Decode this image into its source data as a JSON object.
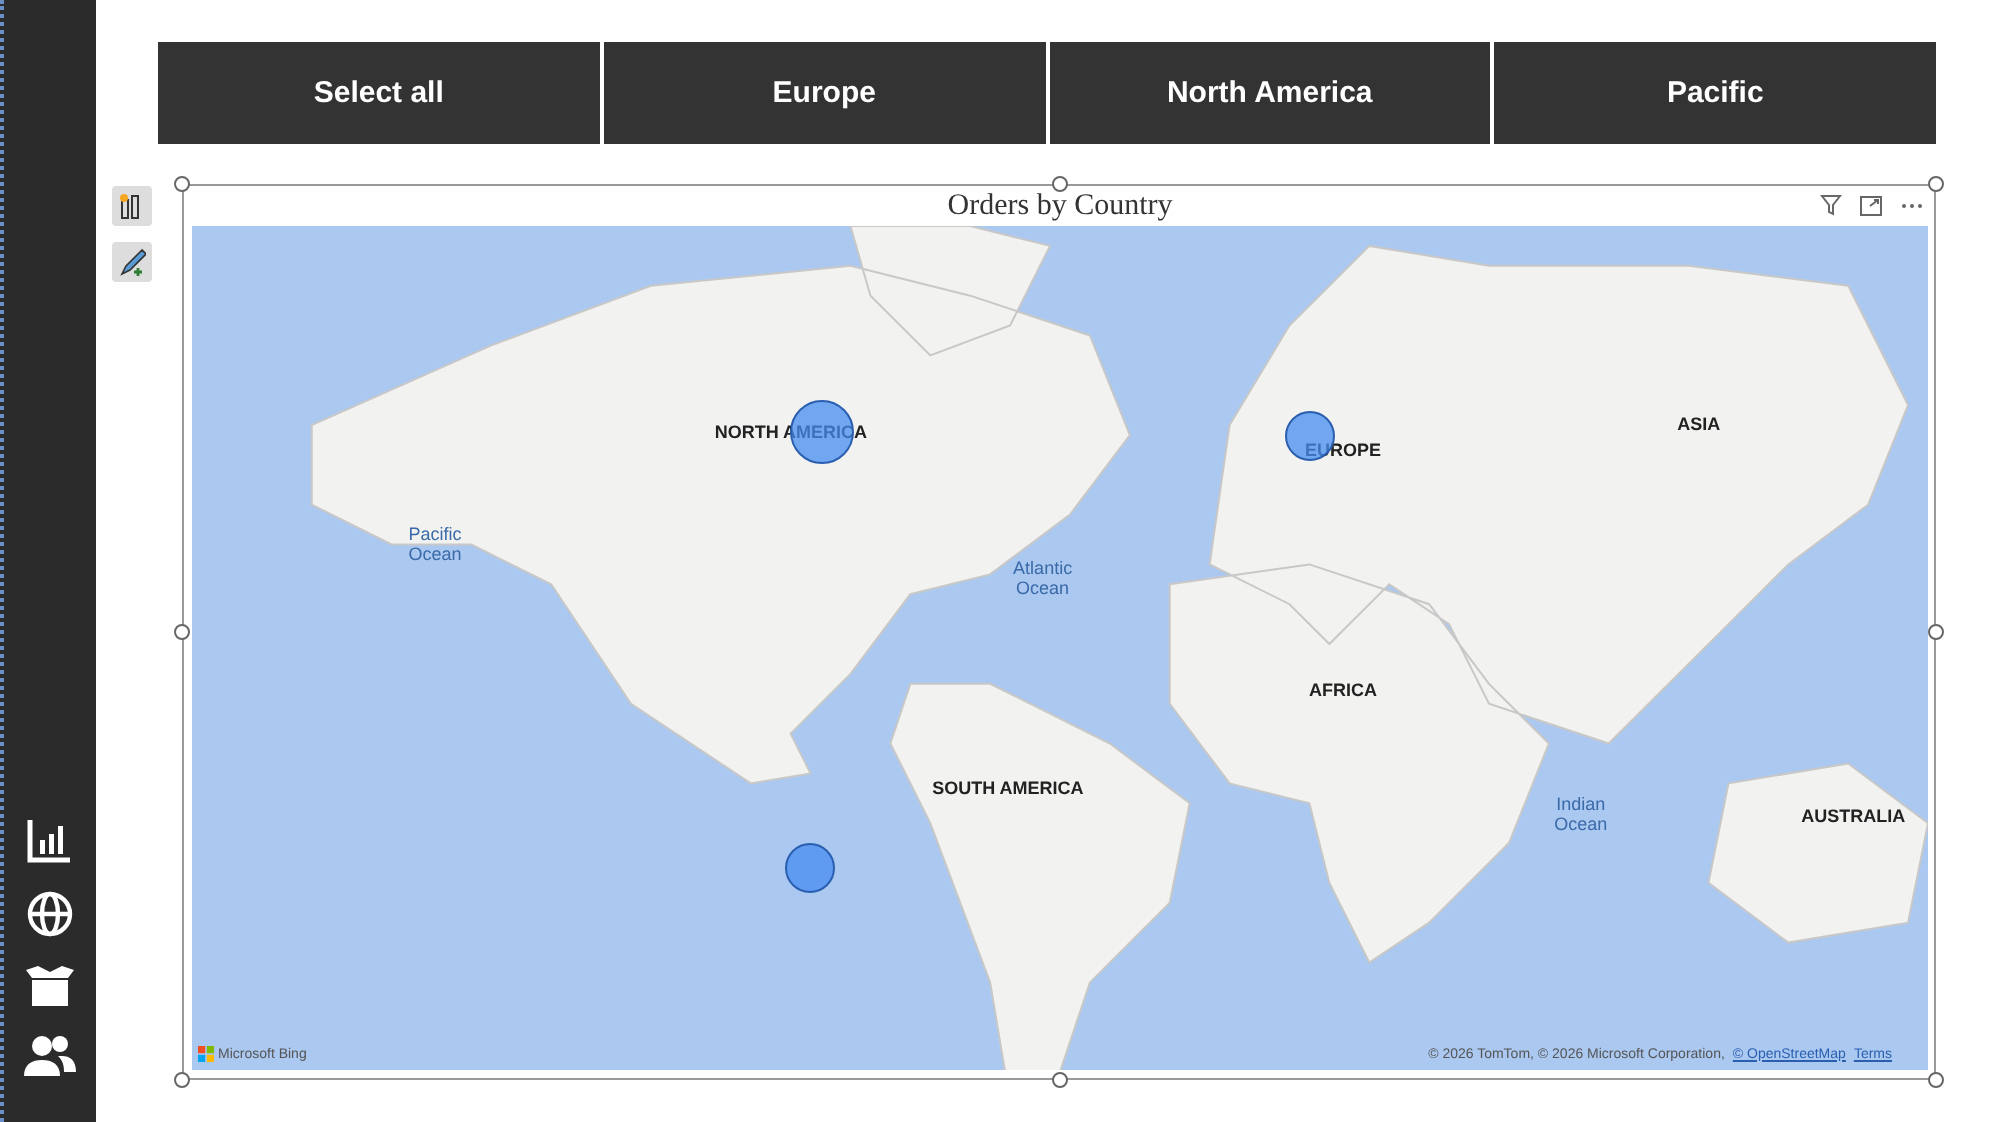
{
  "slicer": {
    "buttons": [
      {
        "label": "Select all",
        "selected": false
      },
      {
        "label": "Europe",
        "selected": false
      },
      {
        "label": "North America",
        "selected": false
      },
      {
        "label": "Pacific",
        "selected": false
      }
    ]
  },
  "visual": {
    "title": "Orders by Country",
    "map": {
      "labels": [
        {
          "text": "NORTH AMERICA",
          "kind": "continent"
        },
        {
          "text": "EUROPE",
          "kind": "continent"
        },
        {
          "text": "ASIA",
          "kind": "continent"
        },
        {
          "text": "AFRICA",
          "kind": "continent"
        },
        {
          "text": "SOUTH AMERICA",
          "kind": "continent"
        },
        {
          "text": "AUSTRALIA",
          "kind": "continent"
        },
        {
          "text": "Pacific\nOcean",
          "kind": "ocean"
        },
        {
          "text": "Atlantic\nOcean",
          "kind": "ocean"
        },
        {
          "text": "Indian\nOcean",
          "kind": "ocean"
        }
      ],
      "bubbles": [
        {
          "kind": "large"
        },
        {
          "kind": "small"
        },
        {
          "kind": "small"
        }
      ],
      "brand": "Microsoft Bing",
      "copyright": "© 2026 TomTom, © 2026 Microsoft Corporation,",
      "links": [
        "© OpenStreetMap",
        "Terms"
      ]
    }
  }
}
